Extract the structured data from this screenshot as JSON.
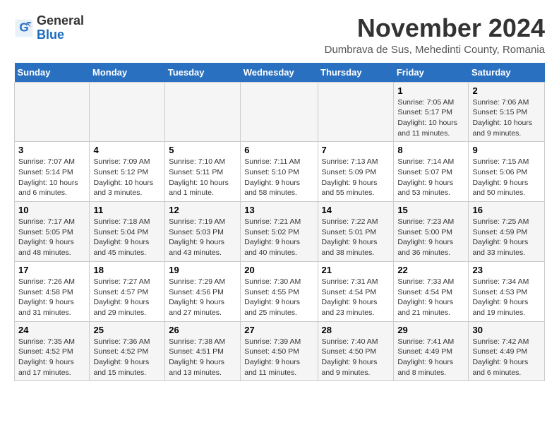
{
  "logo": {
    "general": "General",
    "blue": "Blue"
  },
  "title": "November 2024",
  "location": "Dumbrava de Sus, Mehedinti County, Romania",
  "days_of_week": [
    "Sunday",
    "Monday",
    "Tuesday",
    "Wednesday",
    "Thursday",
    "Friday",
    "Saturday"
  ],
  "weeks": [
    [
      {
        "day": "",
        "info": ""
      },
      {
        "day": "",
        "info": ""
      },
      {
        "day": "",
        "info": ""
      },
      {
        "day": "",
        "info": ""
      },
      {
        "day": "",
        "info": ""
      },
      {
        "day": "1",
        "info": "Sunrise: 7:05 AM\nSunset: 5:17 PM\nDaylight: 10 hours and 11 minutes."
      },
      {
        "day": "2",
        "info": "Sunrise: 7:06 AM\nSunset: 5:15 PM\nDaylight: 10 hours and 9 minutes."
      }
    ],
    [
      {
        "day": "3",
        "info": "Sunrise: 7:07 AM\nSunset: 5:14 PM\nDaylight: 10 hours and 6 minutes."
      },
      {
        "day": "4",
        "info": "Sunrise: 7:09 AM\nSunset: 5:12 PM\nDaylight: 10 hours and 3 minutes."
      },
      {
        "day": "5",
        "info": "Sunrise: 7:10 AM\nSunset: 5:11 PM\nDaylight: 10 hours and 1 minute."
      },
      {
        "day": "6",
        "info": "Sunrise: 7:11 AM\nSunset: 5:10 PM\nDaylight: 9 hours and 58 minutes."
      },
      {
        "day": "7",
        "info": "Sunrise: 7:13 AM\nSunset: 5:09 PM\nDaylight: 9 hours and 55 minutes."
      },
      {
        "day": "8",
        "info": "Sunrise: 7:14 AM\nSunset: 5:07 PM\nDaylight: 9 hours and 53 minutes."
      },
      {
        "day": "9",
        "info": "Sunrise: 7:15 AM\nSunset: 5:06 PM\nDaylight: 9 hours and 50 minutes."
      }
    ],
    [
      {
        "day": "10",
        "info": "Sunrise: 7:17 AM\nSunset: 5:05 PM\nDaylight: 9 hours and 48 minutes."
      },
      {
        "day": "11",
        "info": "Sunrise: 7:18 AM\nSunset: 5:04 PM\nDaylight: 9 hours and 45 minutes."
      },
      {
        "day": "12",
        "info": "Sunrise: 7:19 AM\nSunset: 5:03 PM\nDaylight: 9 hours and 43 minutes."
      },
      {
        "day": "13",
        "info": "Sunrise: 7:21 AM\nSunset: 5:02 PM\nDaylight: 9 hours and 40 minutes."
      },
      {
        "day": "14",
        "info": "Sunrise: 7:22 AM\nSunset: 5:01 PM\nDaylight: 9 hours and 38 minutes."
      },
      {
        "day": "15",
        "info": "Sunrise: 7:23 AM\nSunset: 5:00 PM\nDaylight: 9 hours and 36 minutes."
      },
      {
        "day": "16",
        "info": "Sunrise: 7:25 AM\nSunset: 4:59 PM\nDaylight: 9 hours and 33 minutes."
      }
    ],
    [
      {
        "day": "17",
        "info": "Sunrise: 7:26 AM\nSunset: 4:58 PM\nDaylight: 9 hours and 31 minutes."
      },
      {
        "day": "18",
        "info": "Sunrise: 7:27 AM\nSunset: 4:57 PM\nDaylight: 9 hours and 29 minutes."
      },
      {
        "day": "19",
        "info": "Sunrise: 7:29 AM\nSunset: 4:56 PM\nDaylight: 9 hours and 27 minutes."
      },
      {
        "day": "20",
        "info": "Sunrise: 7:30 AM\nSunset: 4:55 PM\nDaylight: 9 hours and 25 minutes."
      },
      {
        "day": "21",
        "info": "Sunrise: 7:31 AM\nSunset: 4:54 PM\nDaylight: 9 hours and 23 minutes."
      },
      {
        "day": "22",
        "info": "Sunrise: 7:33 AM\nSunset: 4:54 PM\nDaylight: 9 hours and 21 minutes."
      },
      {
        "day": "23",
        "info": "Sunrise: 7:34 AM\nSunset: 4:53 PM\nDaylight: 9 hours and 19 minutes."
      }
    ],
    [
      {
        "day": "24",
        "info": "Sunrise: 7:35 AM\nSunset: 4:52 PM\nDaylight: 9 hours and 17 minutes."
      },
      {
        "day": "25",
        "info": "Sunrise: 7:36 AM\nSunset: 4:52 PM\nDaylight: 9 hours and 15 minutes."
      },
      {
        "day": "26",
        "info": "Sunrise: 7:38 AM\nSunset: 4:51 PM\nDaylight: 9 hours and 13 minutes."
      },
      {
        "day": "27",
        "info": "Sunrise: 7:39 AM\nSunset: 4:50 PM\nDaylight: 9 hours and 11 minutes."
      },
      {
        "day": "28",
        "info": "Sunrise: 7:40 AM\nSunset: 4:50 PM\nDaylight: 9 hours and 9 minutes."
      },
      {
        "day": "29",
        "info": "Sunrise: 7:41 AM\nSunset: 4:49 PM\nDaylight: 9 hours and 8 minutes."
      },
      {
        "day": "30",
        "info": "Sunrise: 7:42 AM\nSunset: 4:49 PM\nDaylight: 9 hours and 6 minutes."
      }
    ]
  ]
}
